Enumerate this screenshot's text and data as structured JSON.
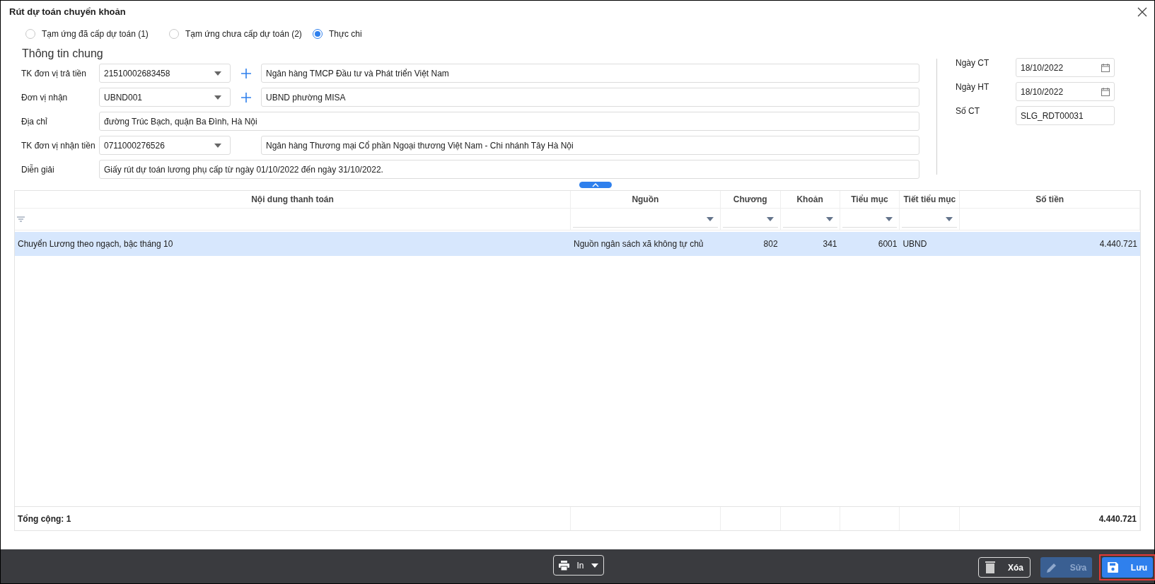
{
  "window": {
    "title": "Rút dự toán chuyển khoản"
  },
  "payment_types": [
    {
      "label": "Tạm ứng đã cấp dự toán (1)",
      "selected": false
    },
    {
      "label": "Tạm ứng chưa cấp dự toán (2)",
      "selected": false
    },
    {
      "label": "Thực chi",
      "selected": true
    }
  ],
  "section_title": "Thông tin chung",
  "form_rows": [
    {
      "kind": "combo-add",
      "label": "TK đơn vị trả tiền",
      "code": "21510002683458",
      "name": "Ngân hàng TMCP Đầu tư và Phát triển Việt Nam"
    },
    {
      "kind": "combo-add",
      "label": "Đơn vị nhận",
      "code": "UBND001",
      "name": "UBND phường MISA"
    },
    {
      "kind": "text",
      "label": "Địa chỉ",
      "name": "đường Trúc Bạch, quận Ba Đình, Hà Nội"
    },
    {
      "kind": "combo",
      "label": "TK đơn vị nhận tiền",
      "code": "0711000276526",
      "name": "Ngân hàng Thương mại Cổ phần Ngoại thương Việt Nam - Chi nhánh Tây Hà Nội"
    },
    {
      "kind": "text",
      "label": "Diễn giải",
      "name": "Giấy rút dự toán lương phụ cấp từ ngày 01/10/2022 đến ngày 31/10/2022."
    }
  ],
  "document_fields": [
    {
      "kind": "date",
      "label": "Ngày CT",
      "value": "18/10/2022"
    },
    {
      "kind": "date",
      "label": "Ngày HT",
      "value": "18/10/2022"
    },
    {
      "kind": "text",
      "label": "Số CT",
      "value": "SLG_RDT00031"
    }
  ],
  "table": {
    "columns": [
      {
        "label": "Nội dung thanh toán",
        "kind": "filter-icon",
        "numeric": false
      },
      {
        "label": "Nguồn",
        "kind": "dropdown",
        "numeric": false
      },
      {
        "label": "Chương",
        "kind": "dropdown",
        "numeric": true
      },
      {
        "label": "Khoản",
        "kind": "dropdown",
        "numeric": true
      },
      {
        "label": "Tiểu mục",
        "kind": "dropdown",
        "numeric": true
      },
      {
        "label": "Tiết tiểu mục",
        "kind": "dropdown",
        "numeric": false
      },
      {
        "label": "Số tiền",
        "kind": "plain",
        "numeric": true
      }
    ],
    "rows": [
      {
        "selected": true,
        "cells": [
          "Chuyển Lương theo ngạch, bậc tháng 10",
          "Nguồn ngân sách xã không tự chủ",
          "802",
          "341",
          "6001",
          "UBND",
          "4.440.721"
        ]
      }
    ],
    "footer": {
      "label": "Tổng cộng: 1",
      "total": "4.440.721"
    }
  },
  "buttons": [
    {
      "kind": "print",
      "label": "In",
      "disabled": false,
      "highlighted": false
    },
    {
      "kind": "delete",
      "label": "Xóa",
      "disabled": false,
      "highlighted": false
    },
    {
      "kind": "edit",
      "label": "Sửa",
      "disabled": true,
      "highlighted": false
    },
    {
      "kind": "save",
      "label": "Lưu",
      "disabled": false,
      "highlighted": true
    }
  ]
}
